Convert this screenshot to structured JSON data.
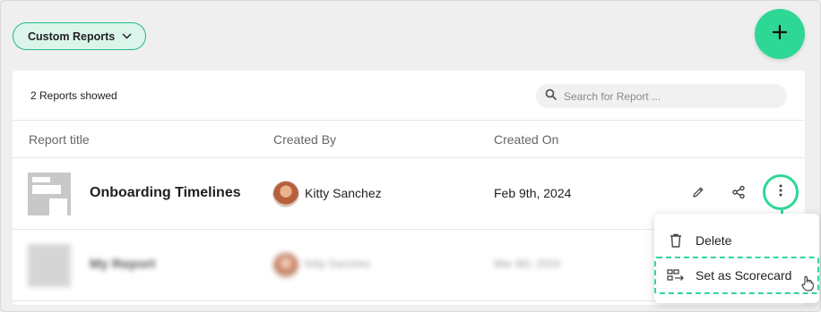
{
  "filter": {
    "label": "Custom Reports"
  },
  "fab": {
    "icon": "plus-icon"
  },
  "toolbar": {
    "count_text": "2 Reports showed",
    "search_placeholder": "Search for Report ..."
  },
  "columns": [
    "Report title",
    "Created By",
    "Created On"
  ],
  "rows": [
    {
      "title": "Onboarding Timelines",
      "created_by": "Kitty Sanchez",
      "created_on": "Feb 9th, 2024"
    },
    {
      "title": "My Report",
      "created_by": "Kitty Sanchez",
      "created_on": "Mar 8th, 2024"
    }
  ],
  "menu": {
    "items": [
      {
        "label": "Delete",
        "icon": "trash-icon"
      },
      {
        "label": "Set as Scorecard",
        "icon": "scorecard-icon"
      }
    ]
  },
  "colors": {
    "accent": "#2fd796",
    "pill_bg": "#dcf5ea",
    "pill_border": "#1fb98a"
  }
}
